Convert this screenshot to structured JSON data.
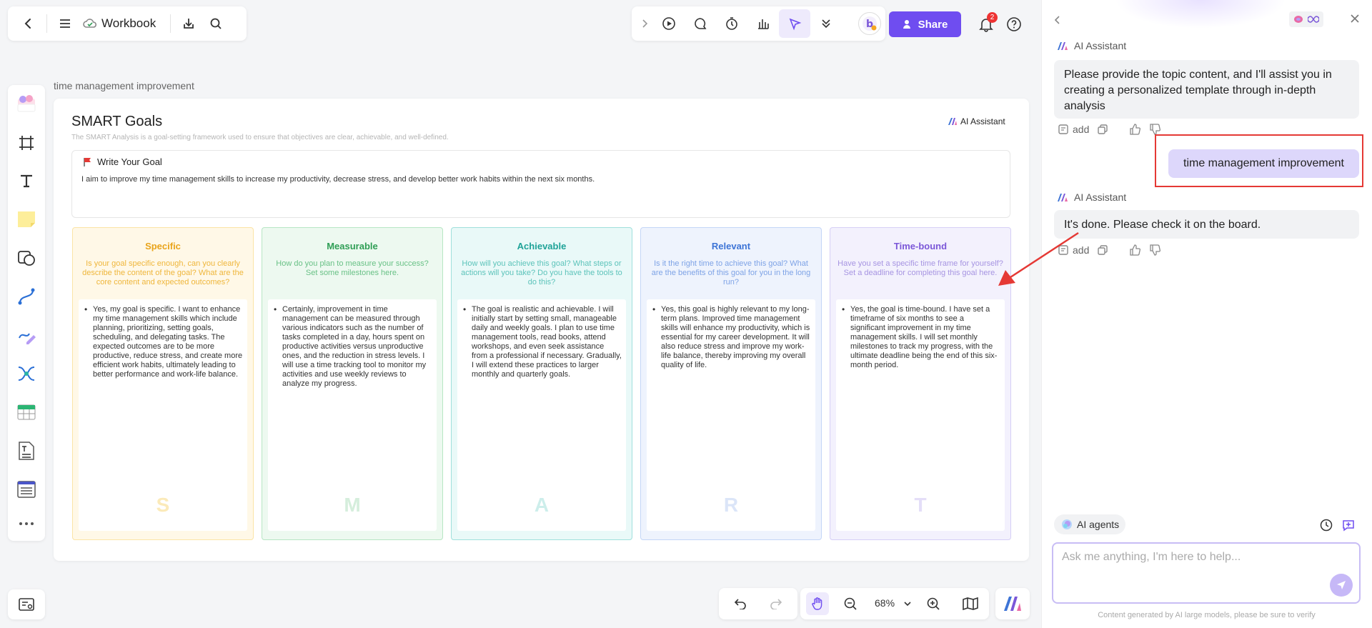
{
  "header": {
    "workbook_title": "Workbook",
    "share_label": "Share",
    "notification_count": "2"
  },
  "board": {
    "label": "time management improvement",
    "title": "SMART Goals",
    "subtitle": "The SMART Analysis is a goal-setting framework used to ensure that objectives are clear, achievable, and well-defined.",
    "ai_label": "AI Assistant",
    "goal_heading": "Write Your Goal",
    "goal_text": "I aim to improve my time management skills to increase my productivity, decrease stress, and develop better work habits within the next six months.",
    "columns": [
      {
        "title": "Specific",
        "question": "Is your goal specific enough, can you clearly describe the content of the goal? What are the core content and expected outcomes?",
        "answer": "Yes, my goal is specific. I want to enhance my time management skills which include planning, prioritizing, setting goals, scheduling, and delegating tasks. The expected outcomes are to be more productive, reduce stress, and create more efficient work habits, ultimately leading to better performance and work-life balance.",
        "letter": "S",
        "bg": "#fff8e7",
        "border": "#fbe4a6",
        "title_color": "#e9a41b",
        "q_color": "#efb63b",
        "letter_color": "#fbeab9"
      },
      {
        "title": "Measurable",
        "question": "How do you plan to measure your success? Set some milestones here.",
        "answer": "Certainly, improvement in time management can be measured through various indicators such as the number of tasks completed in a day, hours spent on productive activities versus unproductive ones, and the reduction in stress levels. I will use a time tracking tool to monitor my activities and use weekly reviews to analyze my progress.",
        "letter": "M",
        "bg": "#edf9f0",
        "border": "#b7e6c4",
        "title_color": "#2f9e55",
        "q_color": "#69c186",
        "letter_color": "#d5eedc"
      },
      {
        "title": "Achievable",
        "question": "How will you achieve this goal? What steps or actions will you take? Do you have the tools to do this?",
        "answer": "The goal is realistic and achievable. I will initially start by setting small, manageable daily and weekly goals. I plan to use time management tools, read books, attend workshops, and even seek assistance from a professional if necessary. Gradually, I will extend these practices to larger monthly and quarterly goals.",
        "letter": "A",
        "bg": "#e9f9f8",
        "border": "#9fe0dc",
        "title_color": "#1fa398",
        "q_color": "#5cc3ba",
        "letter_color": "#cdeeeb"
      },
      {
        "title": "Relevant",
        "question": "Is it the right time to achieve this goal? What are the benefits of this goal for you in the long run?",
        "answer": "Yes, this goal is highly relevant to my long-term plans. Improved time management skills will enhance my productivity, which is essential for my career development. It will also reduce stress and improve my work-life balance, thereby improving my overall quality of life.",
        "letter": "R",
        "bg": "#eef3fd",
        "border": "#c4d6f7",
        "title_color": "#3d74d6",
        "q_color": "#7ea3e6",
        "letter_color": "#dbe5f8"
      },
      {
        "title": "Time-bound",
        "question": "Have you set a specific time frame for yourself? Set a deadline for completing this goal here.",
        "answer": "Yes, the goal is time-bound. I have set a timeframe of six months to see a significant improvement in my time management skills. I will set monthly milestones to track my progress, with the ultimate deadline being the end of this six-month period.",
        "letter": "T",
        "bg": "#f3f1fd",
        "border": "#d6cff6",
        "title_color": "#7b57d8",
        "q_color": "#a795e2",
        "letter_color": "#e4def8"
      }
    ]
  },
  "zoom": {
    "value": "68%"
  },
  "panel": {
    "ai_name": "AI Assistant",
    "msg1": "Please provide the topic content, and I'll assist you in creating a personalized template through in-depth analysis",
    "add_label": "add",
    "user_msg": "time management improvement",
    "msg2": "It's done. Please check it on the board.",
    "agents_label": "AI agents",
    "input_placeholder": "Ask me anything, I'm here to help...",
    "footer": "Content generated by AI large models, please be sure to verify"
  },
  "colors": {
    "accent": "#6f4df0",
    "highlight": "#e53935"
  }
}
